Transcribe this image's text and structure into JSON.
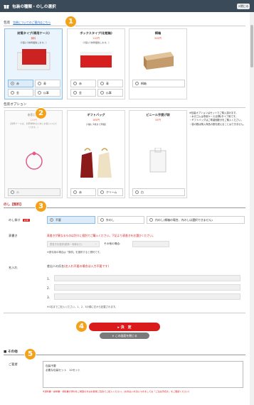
{
  "header": {
    "title": "包装の種類・のしの選択",
    "close_label": "✕閉じる"
  },
  "packaging": {
    "label": "包装",
    "link": "包装についてのご案内はこちら",
    "cards": [
      {
        "title": "封筒タイプ(専用ケース)",
        "price": "無料",
        "note": "(1個に1枚同梱致します。)",
        "options": [
          "赤",
          "青",
          "金",
          "仏事"
        ]
      },
      {
        "title": "ボックスタイプ(化粧箱)",
        "price": "110円",
        "note": "(1個に1枚同梱致します。)",
        "options": [
          "赤",
          "青",
          "金",
          "仏事"
        ]
      },
      {
        "title": "桐箱",
        "price": "500円",
        "note": "",
        "options": [
          "桐箱"
        ]
      }
    ]
  },
  "wrap_options": {
    "label": "包装オプション",
    "cards": [
      {
        "title": "水引ゴム",
        "price": "110円",
        "note": "(封筒ケースは、封筒単体のためにお使いいただけます。)",
        "options": [
          "赤"
        ]
      },
      {
        "title": "ギフトバッグ",
        "price": "165円",
        "note": "(1袋に3枚まで同梱)",
        "options": [
          "赤",
          "クリーム"
        ]
      },
      {
        "title": "ビニール手提げ袋",
        "price": "55円",
        "note": "",
        "options": [
          "白"
        ]
      }
    ],
    "notice": "※包装オプションはセットでご購入頂けます。\n・水引ゴムは専用ケース(封筒)タイプ用です。\n・ギフトバッグはご希望個数分をご購入ください。\n・袋の数は購入商品の数を超えることはできません。"
  },
  "noshi": {
    "label": "のし【無料】",
    "kake_label": "のし掛け",
    "required": "必須",
    "kake_options": [
      "不要",
      "外のし",
      "内のし(桐箱の場合、内のしは選択できません)"
    ],
    "omote_label": "表書き",
    "omote_notice": "表書きが異なるものは別々に個別でご購入ください。下記より表書きをお選びください。",
    "omote_select": "表書きを選択(慶事・弔事など)",
    "omote_other": "その他の場合:",
    "omote_note": "※慶弔用の場合は「御供」を選択すると便利です。",
    "name_label": "名入れ",
    "name_title": "差出人の氏名",
    "name_notice": "(名入れ不要の場合は入力不要です)",
    "name_rows": [
      "1.",
      "2.",
      "3."
    ],
    "name_note": "※3名までご記入ください。1、2、3の順に右から記載されます。"
  },
  "actions": {
    "confirm": "▸ 決　定",
    "cancel": "✕ この画面を閉じる"
  },
  "other": {
    "label": "■ その他",
    "field_label": "ご要望",
    "textarea": "包装不要\n必要な包装セット　10セット",
    "notice": "※送料費・請求書・領収書が添付をご希望の方はお客様ご自身でご記入ください。(お支払い方法につきましては「ご注文手続き」をご確認ください)"
  },
  "badges": [
    "1",
    "2",
    "3",
    "4",
    "5"
  ]
}
